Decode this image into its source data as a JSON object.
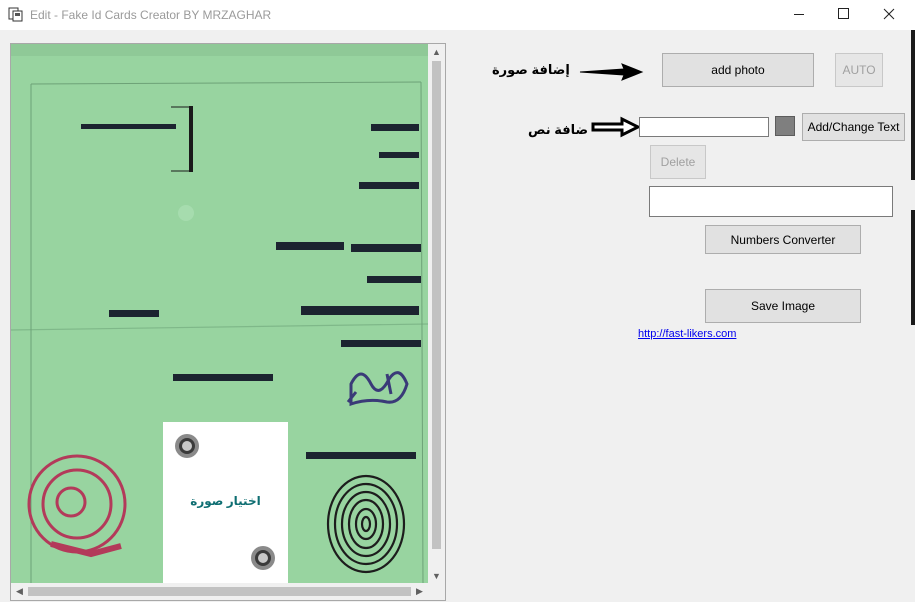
{
  "window": {
    "title": "Edit - Fake Id Cards Creator BY MRZAGHAR"
  },
  "viewer": {
    "photo_placeholder": "اختيار صورة"
  },
  "photo_section": {
    "label": "إضافة صورة",
    "add_photo_label": "add photo",
    "auto_label": "AUTO"
  },
  "text_section": {
    "label": "ضافة نص",
    "text_value": "",
    "color_swatch": "#7f7f7f",
    "add_change_label": "Add/Change Text",
    "delete_label": "Delete"
  },
  "numbers": {
    "input_value": "",
    "converter_label": "Numbers Converter"
  },
  "save_label": "Save Image",
  "link_text": "http://fast-likers.com",
  "colors": {
    "card_green": "#98d4a0",
    "link": "#0000ee"
  }
}
